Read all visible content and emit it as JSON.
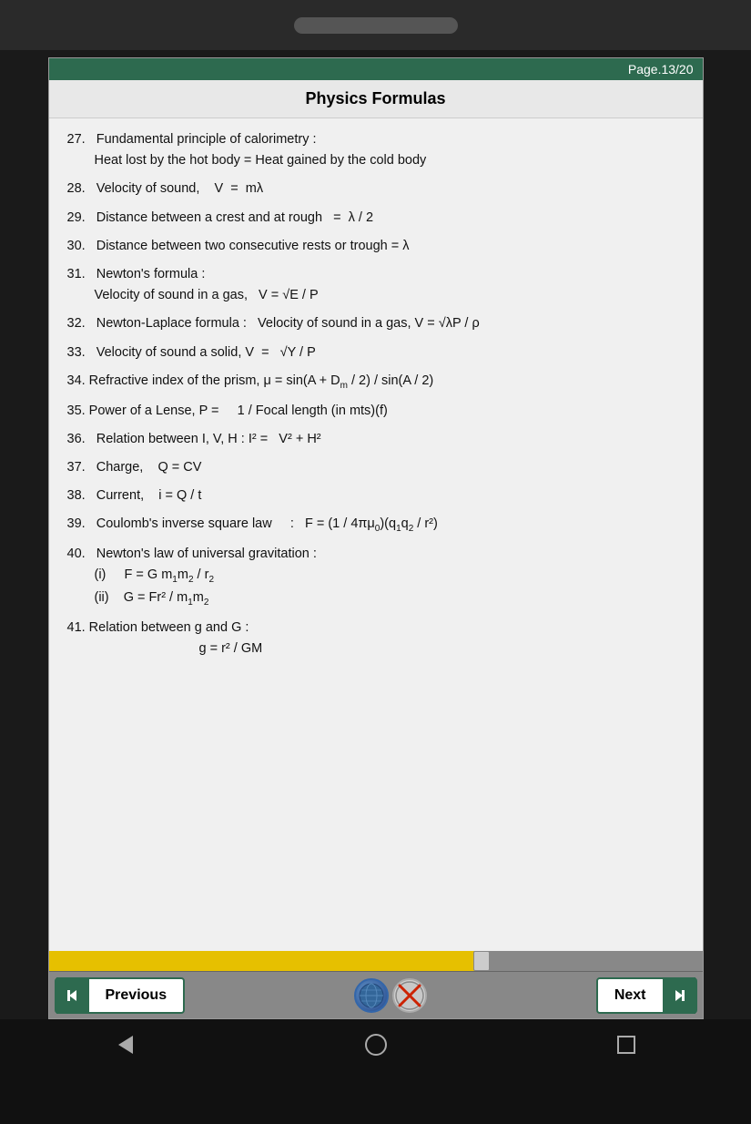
{
  "topbar": {
    "pill": "pill"
  },
  "page": {
    "page_number": "Page.13/20",
    "title": "Physics Formulas"
  },
  "formulas": [
    {
      "id": "27",
      "main": "27.   Fundamental principle of calorimetry :",
      "sub": "Heat lost by the hot body = Heat gained by the cold body"
    },
    {
      "id": "28",
      "main": "28.   Velocity of sound,    V  =   mλ"
    },
    {
      "id": "29",
      "main": "29.   Distance between a crest and at rough   =  λ / 2"
    },
    {
      "id": "30",
      "main": "30.   Distance between two consecutive rests or trough = λ"
    },
    {
      "id": "31",
      "main": "31.   Newton's formula :",
      "sub": "Velocity of sound in a gas,   V = √E / P"
    },
    {
      "id": "32",
      "main": "32.   Newton-Laplace formula :   Velocity of sound in a gas, V = √λP / ρ"
    },
    {
      "id": "33",
      "main": "33.   Velocity of sound a solid, V  =   √Y / P"
    },
    {
      "id": "34",
      "main": "34. Refractive index of the prism, μ = sin(A + D"
    },
    {
      "id": "35",
      "main": "35. Power of a Lense, P =     1 / Focal length (in mts)(f)"
    },
    {
      "id": "36",
      "main": "36.   Relation between I, V, H : I² =   V² + H²"
    },
    {
      "id": "37",
      "main": "37.   Charge,    Q = CV"
    },
    {
      "id": "38",
      "main": "38.   Current,    i = Q / t"
    },
    {
      "id": "39",
      "main": "39.   Coulomb's inverse square law    :   F = (1 / 4πμ"
    },
    {
      "id": "40",
      "main": "40.   Newton's law of universal gravitation :",
      "subs": [
        "(i)    F = G m₁m₂ / r₂",
        "(ii)   G = Fr² / m₁m₂"
      ]
    },
    {
      "id": "41",
      "main": "41. Relation between g and G :",
      "sub2": "g = r² / GM"
    }
  ],
  "nav": {
    "previous_label": "Previous",
    "next_label": "Next"
  },
  "android": {
    "back": "◁",
    "home": "△",
    "recents": "□"
  }
}
